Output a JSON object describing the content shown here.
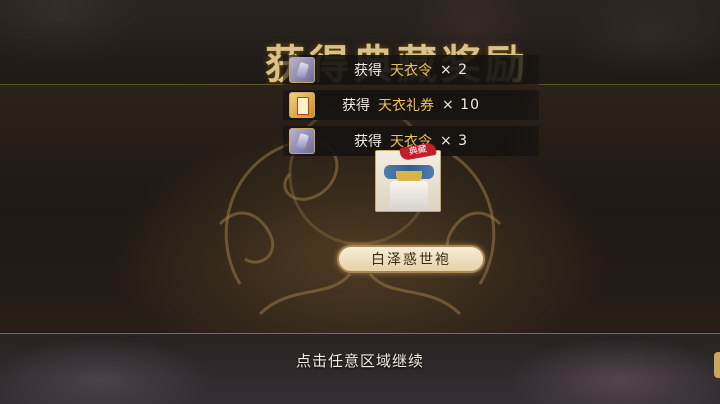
{
  "title": "获得典藏奖励",
  "notifications": [
    {
      "label": "获得",
      "item": "天衣令",
      "quantity": "× 2",
      "icon": "tianyi-token-icon"
    },
    {
      "label": "获得",
      "item": "天衣礼券",
      "quantity": "× 10",
      "icon": "gift-ticket-icon"
    },
    {
      "label": "获得",
      "item": "天衣令",
      "quantity": "× 3",
      "icon": "tianyi-token-icon"
    }
  ],
  "reward": {
    "badge": "典藏",
    "name": "白泽惑世袍"
  },
  "continue_hint": "点击任意区域继续",
  "colors": {
    "gold": "#d9c28a",
    "item_highlight": "#f0c060",
    "panel": "#2b2219"
  }
}
